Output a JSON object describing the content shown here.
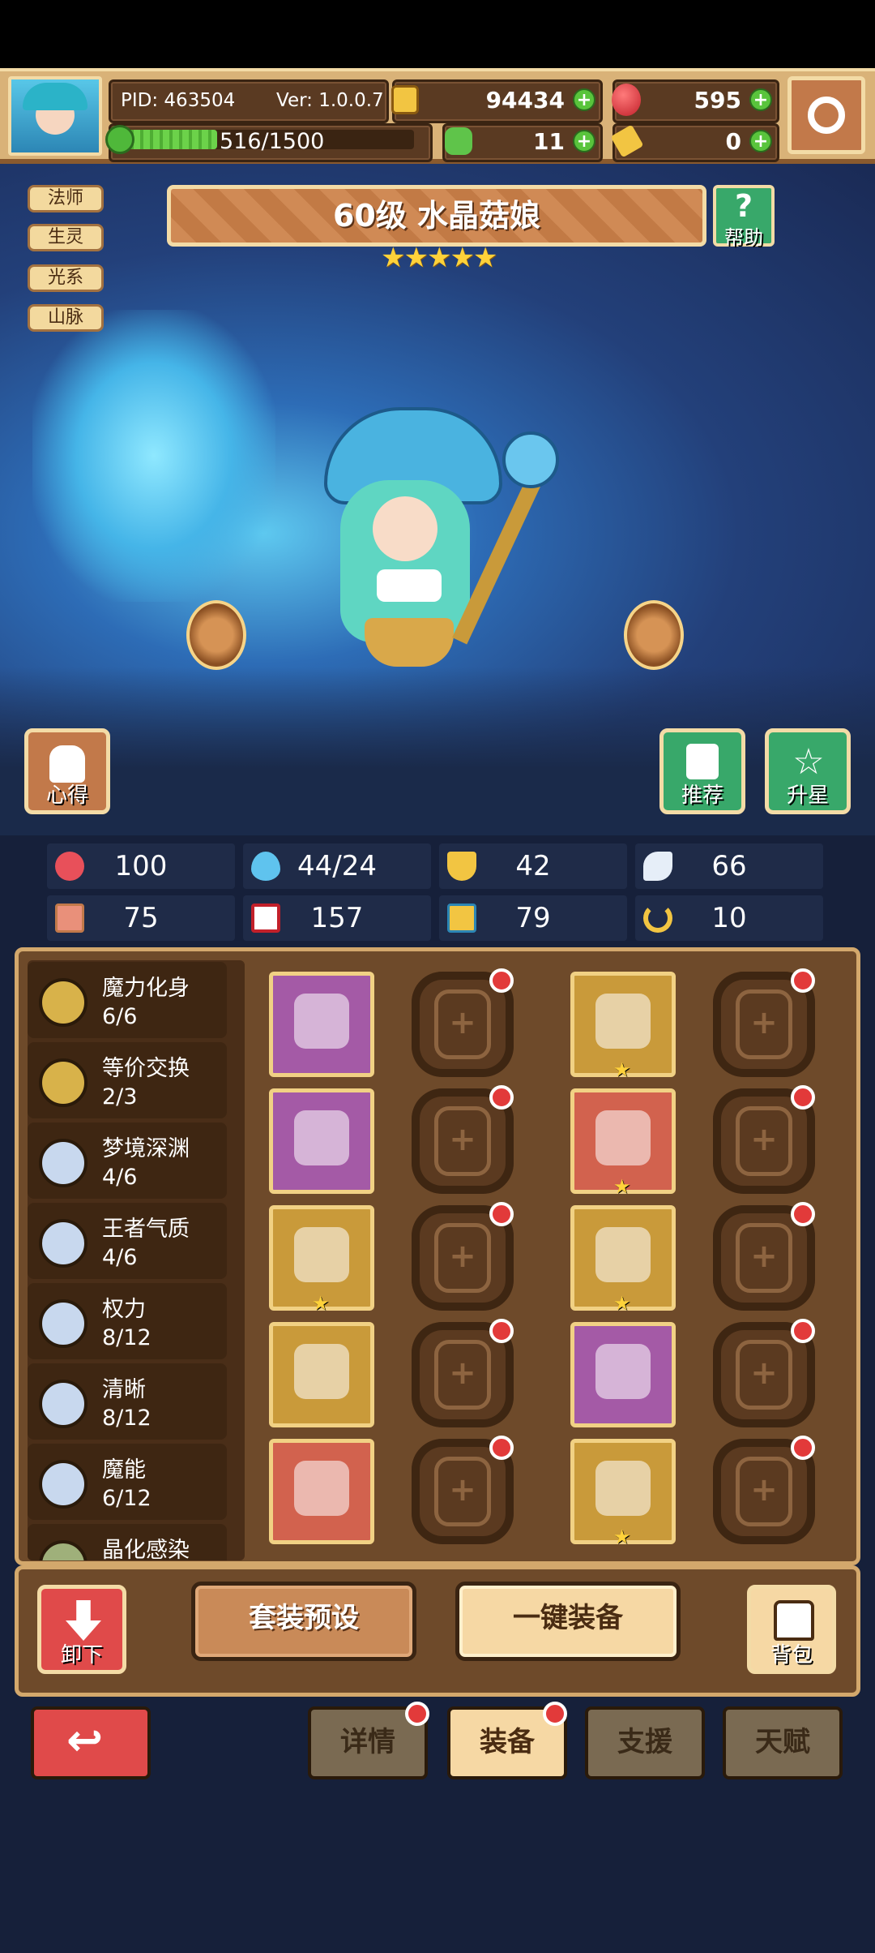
{
  "header": {
    "pid": "PID: 463504",
    "version": "Ver: 1.0.0.7",
    "gold": "94434",
    "gems": "595",
    "exp": "516/1500",
    "exp_fraction": 0.344,
    "clover": "11",
    "key": "0"
  },
  "tags": [
    "法师",
    "生灵",
    "光系",
    "山脉"
  ],
  "character": {
    "title": "60级 水晶菇娘",
    "stars": "★★★★★",
    "help_label": "帮助",
    "tips_label": "心得",
    "recommend_label": "推荐",
    "upstar_label": "升星"
  },
  "stats": [
    {
      "icon": "heart-icon",
      "value": "100"
    },
    {
      "icon": "mana-drop-icon",
      "value": "44/24"
    },
    {
      "icon": "shield-icon",
      "value": "42"
    },
    {
      "icon": "wing-icon",
      "value": "66"
    },
    {
      "icon": "fist-icon",
      "value": "75"
    },
    {
      "icon": "spellbook-icon",
      "value": "157"
    },
    {
      "icon": "boot-icon",
      "value": "79"
    },
    {
      "icon": "horseshoe-icon",
      "value": "10"
    }
  ],
  "sets": [
    {
      "name": "魔力化身",
      "count": "6/6",
      "color": "#d8b24a"
    },
    {
      "name": "等价交换",
      "count": "2/3",
      "color": "#d8b24a"
    },
    {
      "name": "梦境深渊",
      "count": "4/6",
      "color": "#c8d8ee"
    },
    {
      "name": "王者气质",
      "count": "4/6",
      "color": "#c8d8ee"
    },
    {
      "name": "权力",
      "count": "8/12",
      "color": "#c8d8ee"
    },
    {
      "name": "清晰",
      "count": "8/12",
      "color": "#c8d8ee"
    },
    {
      "name": "魔能",
      "count": "6/12",
      "color": "#c8d8ee"
    },
    {
      "name": "晶化感染",
      "count": "",
      "color": "#9fb07a"
    }
  ],
  "equipment": [
    {
      "name": "staff-item-icon",
      "bg": "#a45aa6",
      "star": false
    },
    {
      "name": "hat-item-icon",
      "bg": "#c99a3a",
      "star": true
    },
    {
      "name": "tome-item-icon",
      "bg": "#a45aa6",
      "star": false
    },
    {
      "name": "cloak-item-icon",
      "bg": "#d2624e",
      "star": true
    },
    {
      "name": "amulet-item-icon",
      "bg": "#c99a3a",
      "star": true
    },
    {
      "name": "glove-item-icon",
      "bg": "#c99a3a",
      "star": true
    },
    {
      "name": "heart-wings-item-icon",
      "bg": "#c99a3a",
      "star": false
    },
    {
      "name": "ring-item-icon",
      "bg": "#a45aa6",
      "star": false
    },
    {
      "name": "pot-item-icon",
      "bg": "#d2624e",
      "star": false
    },
    {
      "name": "boots-item-icon",
      "bg": "#c99a3a",
      "star": true
    }
  ],
  "actions": {
    "unequip": "卸下",
    "preset": "套装预设",
    "auto_equip": "一键装备",
    "bag": "背包"
  },
  "tabs": [
    "详情",
    "装备",
    "支援",
    "天赋"
  ]
}
